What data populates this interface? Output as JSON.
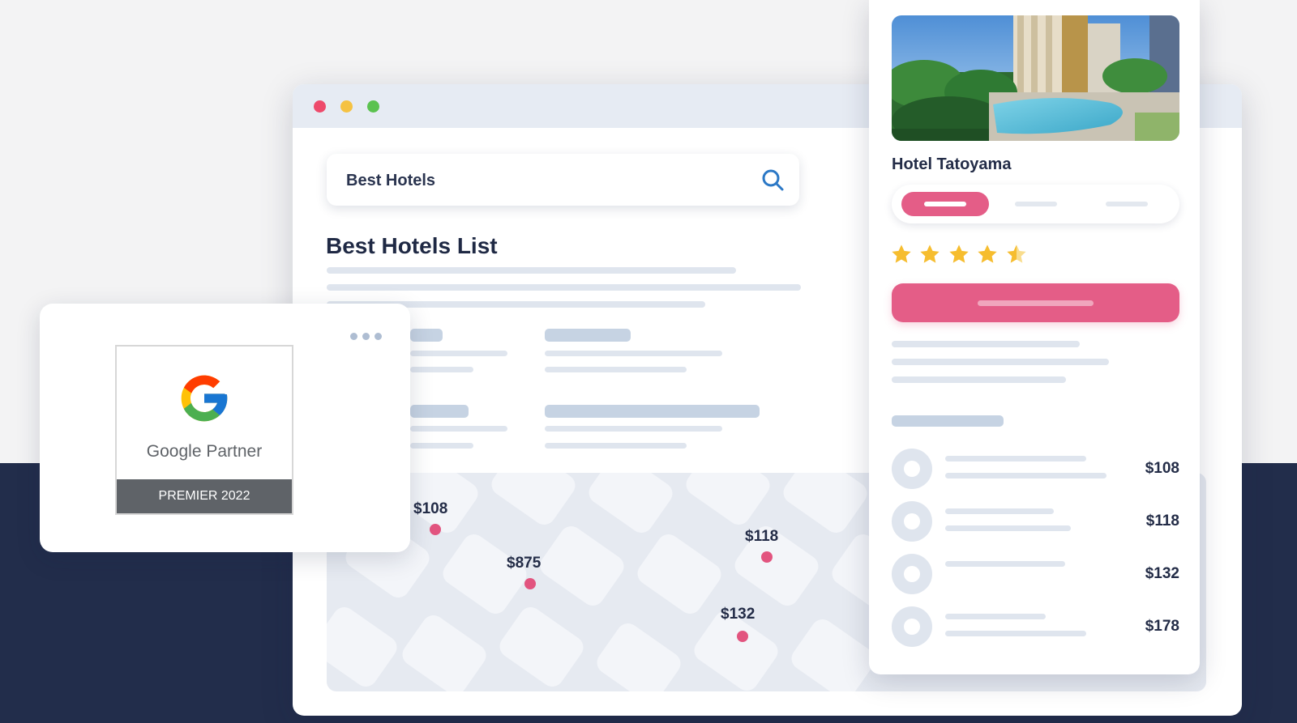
{
  "search": {
    "query": "Best Hotels"
  },
  "list": {
    "title": "Best Hotels List"
  },
  "map": {
    "pins": [
      {
        "price": "$108"
      },
      {
        "price": "$875"
      },
      {
        "price": "$118"
      },
      {
        "price": "$132"
      }
    ]
  },
  "partner": {
    "name": "Google Partner",
    "level": "PREMIER 2022"
  },
  "hotel": {
    "name": "Hotel Tatoyama",
    "rating": 4.5,
    "max_rating": 5,
    "rooms": [
      {
        "price": "$108"
      },
      {
        "price": "$118"
      },
      {
        "price": "$132"
      },
      {
        "price": "$178"
      }
    ]
  },
  "colors": {
    "accent": "#e45d87",
    "navy": "#222d4b",
    "star": "#f6bd2f",
    "placeholder": "#dfe5ee"
  },
  "icons": [
    "search-icon",
    "more-dots-icon",
    "google-g-icon",
    "star-icon",
    "half-star-icon",
    "room-icon"
  ]
}
